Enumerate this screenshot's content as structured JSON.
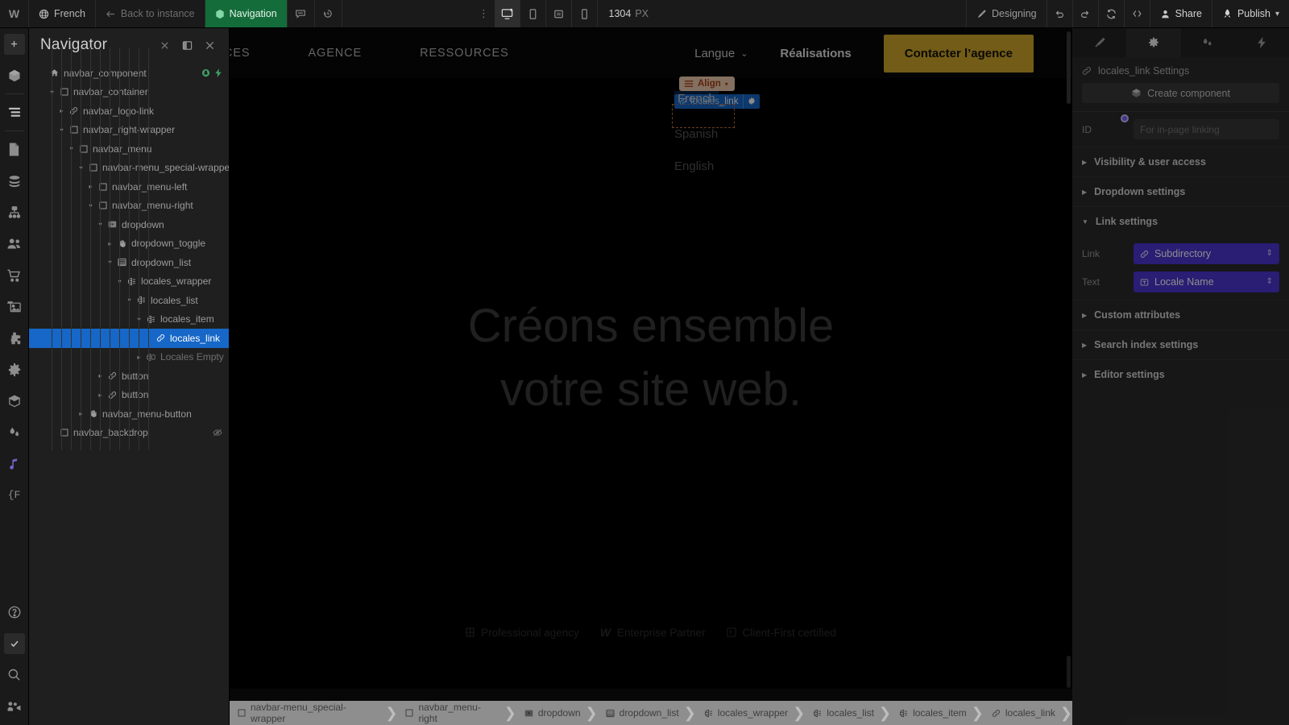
{
  "topbar": {
    "logo": "W",
    "locale": {
      "label": "French",
      "icon": "globe-icon"
    },
    "back": {
      "label": "Back to instance",
      "icon": "arrow-left-icon"
    },
    "page": {
      "label": "Navigation",
      "icon": "component-icon"
    },
    "comment_icon": "comment-icon",
    "history_icon": "history-icon",
    "more_icon": "ellipsis-vertical-icon",
    "viewports": [
      {
        "name": "viewport-desktop",
        "icon": "desktop-icon",
        "active": true
      },
      {
        "name": "viewport-tablet",
        "icon": "tablet-icon",
        "active": false
      },
      {
        "name": "viewport-mobile-landscape",
        "icon": "mobile-landscape-icon",
        "active": false
      },
      {
        "name": "viewport-mobile",
        "icon": "mobile-icon",
        "active": false
      }
    ],
    "canvas_size": "1304",
    "canvas_unit": "PX",
    "mode": {
      "label": "Designing",
      "icon": "brush-icon"
    },
    "undo_icon": "undo-icon",
    "redo_icon": "redo-icon",
    "refresh_icon": "refresh-icon",
    "code_icon": "code-icon",
    "share": {
      "label": "Share",
      "icon": "person-icon"
    },
    "publish": {
      "label": "Publish",
      "icon": "rocket-icon",
      "caret": "chevron-down-icon"
    }
  },
  "left_toolbar": {
    "items": [
      {
        "name": "add-elements",
        "icon": "plus-icon"
      },
      {
        "name": "components",
        "icon": "cube-icon"
      },
      {
        "name": "navigator",
        "icon": "layers-icon"
      },
      {
        "name": "pages",
        "icon": "page-icon"
      },
      {
        "name": "cms",
        "icon": "database-icon"
      },
      {
        "name": "logic",
        "icon": "sitemap-icon"
      },
      {
        "name": "users",
        "icon": "users-icon"
      },
      {
        "name": "ecommerce",
        "icon": "cart-icon"
      },
      {
        "name": "assets",
        "icon": "images-icon"
      },
      {
        "name": "apps",
        "icon": "puzzle-icon"
      },
      {
        "name": "settings",
        "icon": "gear-icon"
      },
      {
        "name": "libraries",
        "icon": "cube-outline-icon"
      },
      {
        "name": "variables",
        "icon": "drops-icon"
      },
      {
        "name": "interactions",
        "icon": "music-note-icon"
      },
      {
        "name": "variable-mode",
        "icon": "brace-f-icon"
      },
      {
        "name": "help",
        "icon": "question-circle-icon"
      },
      {
        "name": "audit",
        "icon": "check-square-icon"
      },
      {
        "name": "search",
        "icon": "search-icon"
      },
      {
        "name": "video",
        "icon": "video-icon"
      }
    ]
  },
  "navigator": {
    "title": "Navigator",
    "header_icons": [
      "close-small-icon",
      "panel-layout-icon",
      "close-icon"
    ],
    "tree": [
      {
        "label": "navbar_component",
        "depth": 0,
        "icon": "home-icon",
        "caret": "none",
        "badges": [
          "locked-icon",
          "interaction-icon"
        ]
      },
      {
        "label": "navbar_container",
        "depth": 1,
        "icon": "div-icon",
        "caret": "down"
      },
      {
        "label": "navbar_logo-link",
        "depth": 2,
        "icon": "link-icon",
        "caret": "right"
      },
      {
        "label": "navbar_right-wrapper",
        "depth": 2,
        "icon": "div-icon",
        "caret": "down"
      },
      {
        "label": "navbar_menu",
        "depth": 3,
        "icon": "div-icon",
        "caret": "down"
      },
      {
        "label": "navbar-menu_special-wrapper",
        "depth": 4,
        "icon": "div-icon",
        "caret": "down"
      },
      {
        "label": "navbar_menu-left",
        "depth": 5,
        "icon": "div-icon",
        "caret": "right"
      },
      {
        "label": "navbar_menu-right",
        "depth": 5,
        "icon": "div-icon",
        "caret": "down"
      },
      {
        "label": "dropdown",
        "depth": 6,
        "icon": "dropdown-icon",
        "caret": "down"
      },
      {
        "label": "dropdown_toggle",
        "depth": 7,
        "icon": "hand-icon",
        "caret": "right"
      },
      {
        "label": "dropdown_list",
        "depth": 7,
        "icon": "list-icon",
        "caret": "down"
      },
      {
        "label": "locales_wrapper",
        "depth": 8,
        "icon": "locales-icon",
        "caret": "down"
      },
      {
        "label": "locales_list",
        "depth": 9,
        "icon": "locales-icon",
        "caret": "down"
      },
      {
        "label": "locales_item",
        "depth": 10,
        "icon": "locales-icon",
        "caret": "down"
      },
      {
        "label": "locales_link",
        "depth": 11,
        "icon": "link-icon",
        "caret": "none",
        "selected": true
      },
      {
        "label": "Locales Empty",
        "depth": 10,
        "icon": "locales-empty-icon",
        "caret": "right",
        "dim": true
      },
      {
        "label": "button",
        "depth": 6,
        "icon": "link-icon",
        "caret": "right"
      },
      {
        "label": "button",
        "depth": 6,
        "icon": "link-icon",
        "caret": "right"
      },
      {
        "label": "navbar_menu-button",
        "depth": 4,
        "icon": "hand-icon",
        "caret": "right"
      },
      {
        "label": "navbar_backdrop",
        "depth": 1,
        "icon": "div-icon",
        "caret": "none",
        "badges": [
          "eye-off-icon"
        ]
      }
    ]
  },
  "canvas": {
    "site_nav_links": [
      "ICES",
      "AGENCE",
      "RESSOURCES"
    ],
    "langue": "Langue",
    "realisations": "Réalisations",
    "cta": "Contacter l’agence",
    "hero_line1": "Créons ensemble",
    "hero_line2": "votre site web.",
    "dropdown_options": [
      "French",
      "Spanish",
      "English"
    ],
    "selected_element_tag": "locales_link",
    "align_badge": "Align",
    "footer_badges": [
      {
        "label": "Professional agency",
        "icon": "wf-professional-icon"
      },
      {
        "label": "Enterprise Partner",
        "icon": "webflow-w-icon"
      },
      {
        "label": "Client-First certified",
        "icon": "client-first-icon"
      }
    ]
  },
  "breadcrumb": {
    "items": [
      {
        "label": "navbar-menu_special-wrapper",
        "icon": "div-icon"
      },
      {
        "label": "navbar_menu-right",
        "icon": "div-icon"
      },
      {
        "label": "dropdown",
        "icon": "dropdown-icon"
      },
      {
        "label": "dropdown_list",
        "icon": "list-icon"
      },
      {
        "label": "locales_wrapper",
        "icon": "locales-icon"
      },
      {
        "label": "locales_list",
        "icon": "locales-icon"
      },
      {
        "label": "locales_item",
        "icon": "locales-icon"
      },
      {
        "label": "locales_link",
        "icon": "link-icon"
      }
    ]
  },
  "settings_panel": {
    "tabs": [
      {
        "name": "style-tab",
        "icon": "brush-icon",
        "active": false
      },
      {
        "name": "settings-tab",
        "icon": "gear-icon",
        "active": true
      },
      {
        "name": "variables-tab",
        "icon": "drops-icon",
        "active": false
      },
      {
        "name": "interactions-tab",
        "icon": "lightning-icon",
        "active": false
      }
    ],
    "title": "locales_link Settings",
    "title_icon": "link-icon",
    "create_component": "Create component",
    "create_component_icon": "cube-icon",
    "id_label": "ID",
    "id_placeholder": "For in-page linking",
    "sections": [
      {
        "label": "Visibility & user access",
        "open": false
      },
      {
        "label": "Dropdown settings",
        "open": false
      },
      {
        "label": "Link settings",
        "open": true
      }
    ],
    "link_settings": {
      "link_label": "Link",
      "link_value": "Subdirectory",
      "link_icon": "link-icon",
      "text_label": "Text",
      "text_value": "Locale Name",
      "text_icon": "text-field-icon"
    },
    "sections_after": [
      {
        "label": "Custom attributes",
        "open": false
      },
      {
        "label": "Search index settings",
        "open": false
      },
      {
        "label": "Editor settings",
        "open": false
      }
    ]
  },
  "floating_toolbar": {
    "refresh_icon": "refresh-icon",
    "code_icon": "code-icon",
    "share": "Share",
    "publish": "Publish"
  },
  "colors": {
    "accent_purple": "#7c4dff",
    "selection_blue": "#1667c7",
    "cta_gold": "#cfa82a",
    "publish_green": "#146c3a",
    "align_orange": "#a8431a"
  }
}
